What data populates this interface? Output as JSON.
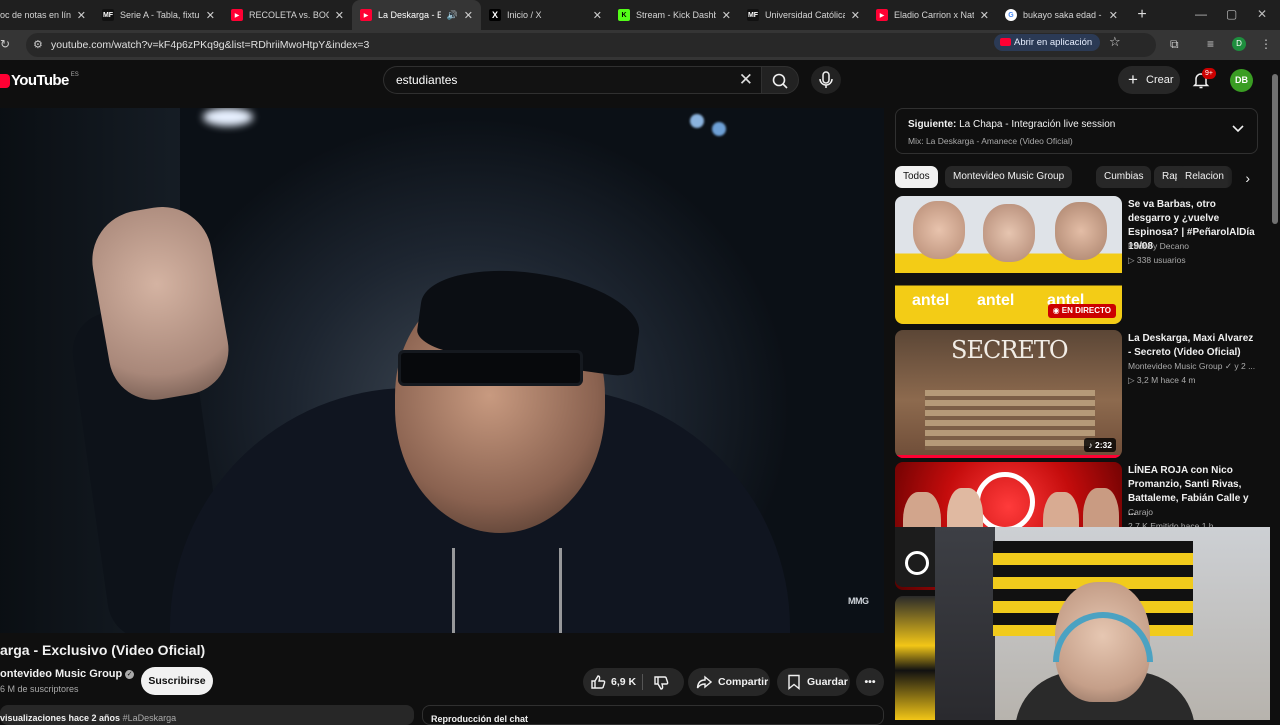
{
  "browser": {
    "tabs": [
      {
        "title": "oc de notas en línea",
        "fav_color": "#4a4a4a",
        "fav": ""
      },
      {
        "title": "Serie A - Tabla, fixture",
        "fav_color": "#111111",
        "fav": "MF"
      },
      {
        "title": "RECOLETA vs. BOCA",
        "fav_color": "#ff0033",
        "fav": "▶"
      },
      {
        "title": "La Deskarga - Exc",
        "fav_color": "#ff0033",
        "fav": "▶"
      },
      {
        "title": "Inicio / X",
        "fav_color": "#000000",
        "fav": "X"
      },
      {
        "title": "Stream - Kick Dashbo",
        "fav_color": "#53fc18",
        "fav": "K"
      },
      {
        "title": "Universidad Católica",
        "fav_color": "#111111",
        "fav": "MF"
      },
      {
        "title": "Eladio Carrion x Nata",
        "fav_color": "#ff0033",
        "fav": "▶"
      },
      {
        "title": "bukayo saka edad - B",
        "fav_color": "#ffffff",
        "fav": "G"
      }
    ],
    "url": "youtube.com/watch?v=kF4p6zPKq9g&list=RDhriiMwoHtpY&index=3",
    "open_in_app": "Abrir en aplicación",
    "profile_initial": "D"
  },
  "youtube": {
    "logo": "YouTube",
    "country": "ES",
    "search_query": "estudiantes",
    "create_label": "Crear",
    "notif_count": "9+",
    "avatar_initials": "DB"
  },
  "video": {
    "watermark": "MMG",
    "title": "arga - Exclusivo (Video Oficial)",
    "channel": "ontevideo Music Group",
    "subscribers": "6 M de suscriptores",
    "subscribe_label": "Suscribirse",
    "likes": "6,9 K",
    "share_label": "Compartir",
    "save_label": "Guardar",
    "desc_line": "visualizaciones  hace 2 años",
    "desc_tag": "#LaDeskarga",
    "chat_label": "Reproducción del chat"
  },
  "next": {
    "label": "Siguiente:",
    "title": "La Chapa - Integración live session",
    "mix": "Mix: La Deskarga - Amanece (Video Oficial)"
  },
  "chips": [
    "Todos",
    "Montevideo Music Group",
    "Cumbias",
    "Rap",
    "Relacion"
  ],
  "recommendations": [
    {
      "title": "Se va Barbas, otro desgarro y ¿vuelve Espinosa? | #PeñarolAlDía 19/08",
      "channel": "Padre y Decano",
      "meta": "338 usuarios",
      "badge": "EN DIRECTO",
      "thumb_text": "antel"
    },
    {
      "title": "La Deskarga, Maxi Alvarez - Secreto (Video Oficial)",
      "channel": "Montevideo Music Group",
      "channel_suffix": "y 2 ...",
      "meta": "3,2 M  hace 4 m",
      "duration": "2:32",
      "thumb_text": "SECRETO"
    },
    {
      "title": "LÍNEA ROJA con Nico Promanzio, Santi Rivas, Battaleme, Fabián Calle y ...",
      "channel": "Carajo",
      "meta": "2,7 K  Emitido hace 1 h"
    }
  ]
}
